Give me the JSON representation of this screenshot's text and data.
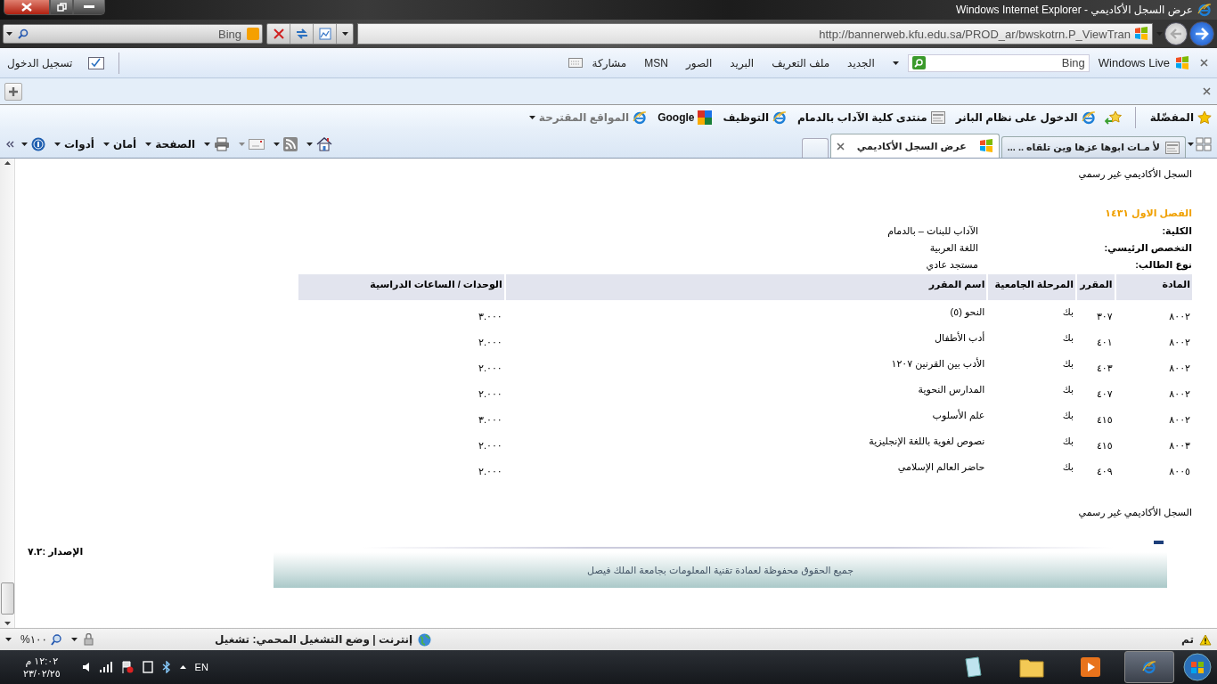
{
  "window": {
    "title": "عرض السجل الأكاديمي - Windows Internet Explorer"
  },
  "address_bar": {
    "url": "http://bannerweb.kfu.edu.sa/PROD_ar/bwskotrn.P_ViewTran"
  },
  "search_box": {
    "value": "Bing"
  },
  "live_toolbar": {
    "brand": "Windows Live",
    "search_value": "Bing",
    "links": [
      "الجديد",
      "ملف التعريف",
      "البريد",
      "الصور",
      "MSN",
      "مشاركة"
    ],
    "sign_in": "تسجيل الدخول"
  },
  "favorites_bar": {
    "label": "المفضّلة",
    "links": [
      {
        "text": "الدخول على نظام البانر",
        "kind": "ie"
      },
      {
        "text": "منتدى كلية الآداب بالدمام",
        "kind": "page"
      },
      {
        "text": "التوظيف",
        "kind": "ie"
      },
      {
        "text": "Google",
        "kind": "google"
      },
      {
        "text": "المواقع المقترحة",
        "kind": "suggested"
      }
    ]
  },
  "tabs": [
    {
      "title": "لأ مـات ابوها عزها وين تلقاه .. ...",
      "kind": "page",
      "selected": false
    },
    {
      "title": "عرض السجل الأكاديمي",
      "kind": "site",
      "selected": true
    }
  ],
  "command_bar": {
    "menus": [
      "الصفحة",
      "أمان",
      "أدوات"
    ]
  },
  "page": {
    "heading": "السجل الأكاديمي غير رسمي",
    "term": "الفصل الاول ١٤٣١",
    "fields": [
      {
        "label": "الكلية:",
        "value": "الآداب للبنات – بالدمام"
      },
      {
        "label": "التخصص الرئيسي:",
        "value": "اللغة العربية"
      },
      {
        "label": "نوع الطالب:",
        "value": "مستجد عادي"
      }
    ],
    "table": {
      "columns": [
        "المادة",
        "المقرر",
        "المرحلة الجامعية",
        "اسم المقرر",
        "الوحدات / الساعات الدراسية"
      ],
      "rows": [
        [
          "٨٠٠٢",
          "٣٠٧",
          "بك",
          "النحو (٥)",
          "٣.٠٠٠"
        ],
        [
          "٨٠٠٢",
          "٤٠١",
          "بك",
          "أدب الأطفال",
          "٢.٠٠٠"
        ],
        [
          "٨٠٠٢",
          "٤٠٣",
          "بك",
          "الأدب بين القرنين ١٢٠٧",
          "٢.٠٠٠"
        ],
        [
          "٨٠٠٢",
          "٤٠٧",
          "بك",
          "المدارس النحوية",
          "٢.٠٠٠"
        ],
        [
          "٨٠٠٢",
          "٤١٥",
          "بك",
          "علم الأسلوب",
          "٣.٠٠٠"
        ],
        [
          "٨٠٠٣",
          "٤١٥",
          "بك",
          "نصوص لغوية باللغة الإنجليزية",
          "٢.٠٠٠"
        ],
        [
          "٨٠٠٥",
          "٤٠٩",
          "بك",
          "حاضر العالم الإسلامي",
          "٢.٠٠٠"
        ]
      ]
    },
    "footer_note": "السجل الأكاديمي غير رسمي",
    "version": "الإصدار :٧.٢",
    "copyright": "جميع الحقوق محفوظة لعمادة تقنية المعلومات بجامعة الملك فيصل"
  },
  "status_bar": {
    "status": "تم",
    "zone": "إنترنت | وضع التشغيل المحمي: تشغيل",
    "zoom": "١٠٠%"
  },
  "taskbar": {
    "language": "EN",
    "time": "١٢:٠٢ م",
    "date": "٢٣/٠٢/٢٥"
  }
}
